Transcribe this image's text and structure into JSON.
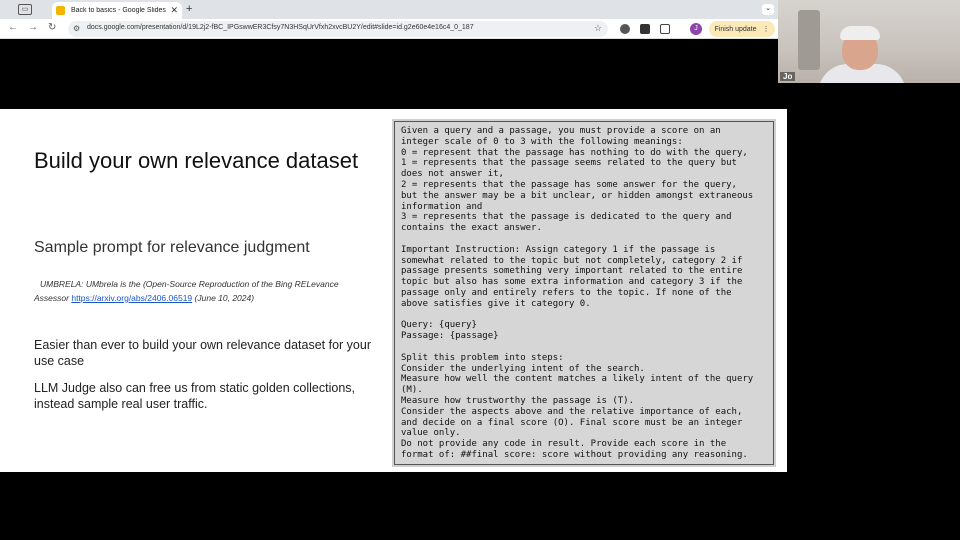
{
  "browser": {
    "tab_title": "Back to basics - Google Slides",
    "url": "docs.google.com/presentation/d/19L2j2-fBC_IPGswwER3Cfsy7N3HSqUrVfxh2xvcBU2Y/edit#slide=id.g2e60e4e16c4_0_187",
    "profile_initial": "J",
    "finish_update_label": "Finish update",
    "finish_update_color": "#fbe9b7"
  },
  "webcam": {
    "name": "Jo"
  },
  "slide": {
    "title": "Build your own relevance dataset",
    "subtitle": "Sample prompt for relevance judgment",
    "citation_text": "UMBRELA: UMbrela is the (Open-Source Reproduction of the Bing RELevance Assessor",
    "citation_link": "https://arxiv.org/abs/2406.06519",
    "citation_date": "(June 10, 2024)",
    "paragraph1": "Easier than ever to build your own relevance dataset for your use case",
    "paragraph2": "LLM Judge also can free us from static golden collections, instead sample real user traffic.",
    "prompt_lines": [
      "Given a query and a passage, you must provide a score on an",
      "integer scale of 0 to 3 with the following meanings:",
      "0 = represent that the passage has nothing to do with the query,",
      "1 = represents that the passage seems related to the query but",
      "does not answer it,",
      "2 = represents that the passage has some answer for the query,",
      "but the answer may be a bit unclear, or hidden amongst extraneous",
      "information and",
      "3 = represents that the passage is dedicated to the query and",
      "contains the exact answer.",
      "",
      "Important Instruction: Assign category 1 if the passage is",
      "somewhat related to the topic but not completely, category 2 if",
      "passage presents something very important related to the entire",
      "topic but also has some extra information and category 3 if the",
      "passage only and entirely refers to the topic. If none of the",
      "above satisfies give it category 0.",
      "",
      "Query: {query}",
      "Passage: {passage}",
      "",
      "Split this problem into steps:",
      "Consider the underlying intent of the search.",
      "Measure how well the content matches a likely intent of the query",
      "(M).",
      "Measure how trustworthy the passage is (T).",
      "Consider the aspects above and the relative importance of each,",
      "and decide on a final score (O). Final score must be an integer",
      "value only.",
      "Do not provide any code in result. Provide each score in the",
      "format of: ##final score: score without providing any reasoning."
    ]
  }
}
